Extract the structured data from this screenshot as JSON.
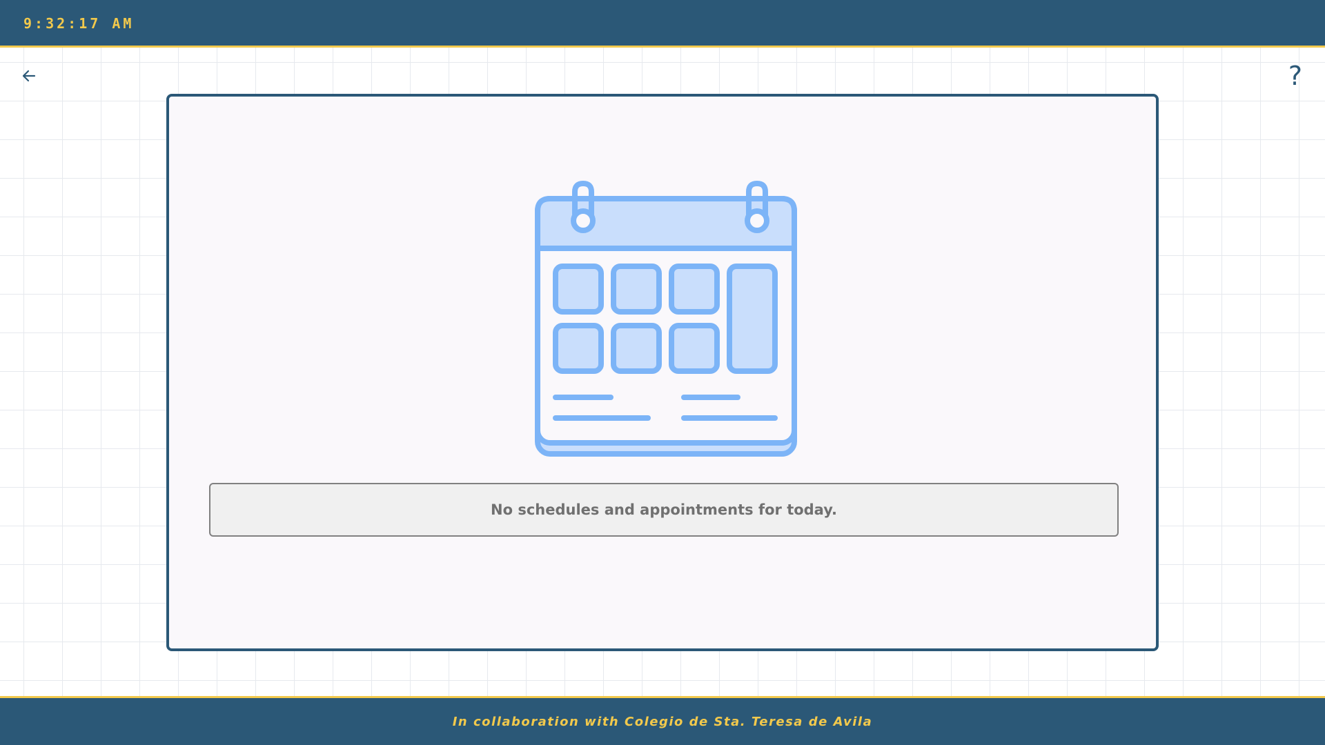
{
  "header": {
    "clock": "9:32:17 AM"
  },
  "nav": {
    "back_icon": "arrow-left-icon",
    "help_label": "?"
  },
  "main": {
    "illustration_icon": "calendar-icon",
    "empty_message": "No schedules and appointments for today."
  },
  "footer": {
    "text": "In collaboration with Colegio de Sta. Teresa de Avila"
  },
  "colors": {
    "brand": "#2b5877",
    "accent": "#f2c94c",
    "illustration_stroke": "#7cb4f7",
    "illustration_fill": "#c9defc"
  }
}
